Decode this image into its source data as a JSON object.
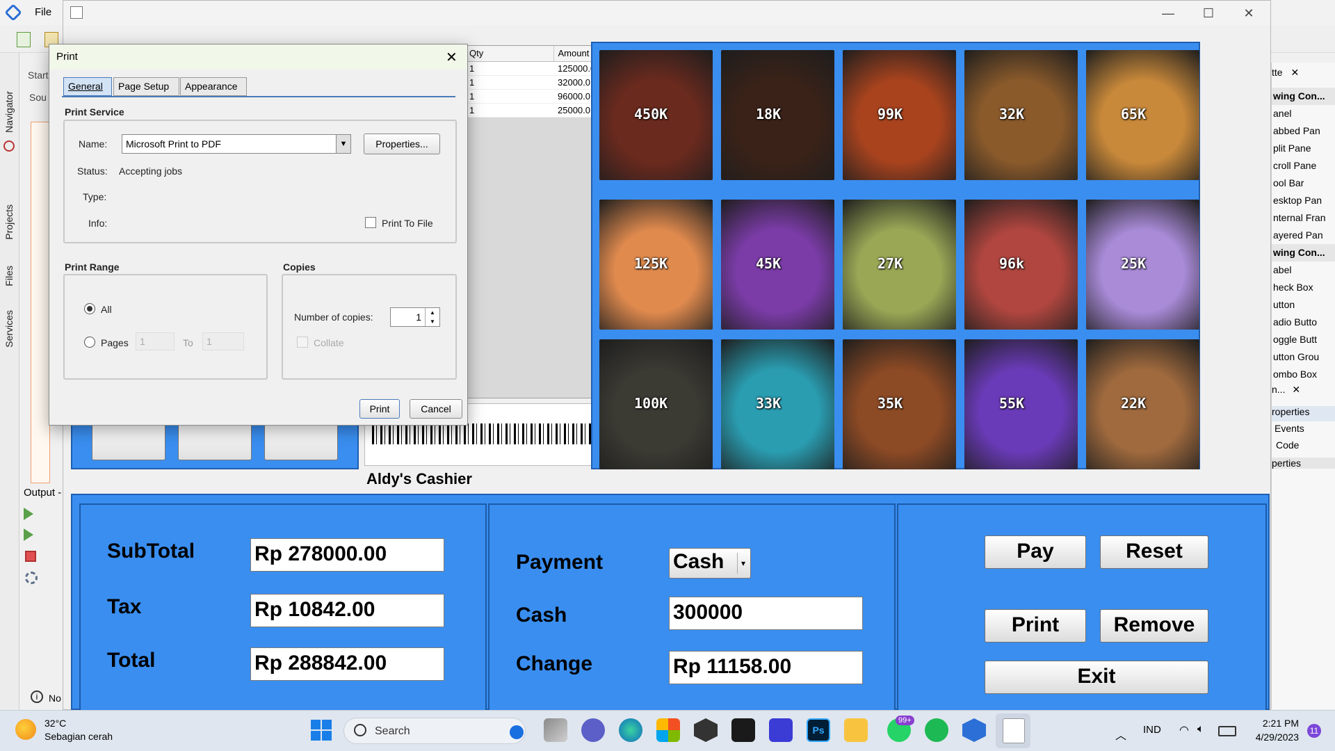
{
  "ide": {
    "menu_file": "File",
    "left_tabs": [
      "Navigator",
      "Projects",
      "Files",
      "Services"
    ],
    "output_label": "Output -",
    "start_tab": "Start",
    "source_tab": "Sou",
    "notifications_label": "No",
    "palette_items": [
      "wing Con...",
      "anel",
      "abbed Pan",
      "plit Pane",
      "croll Pane",
      "ool Bar",
      "esktop Pan",
      "nternal Fran",
      "ayered Pan",
      "wing Con...",
      "abel",
      "heck Box",
      "utton",
      "adio Butto",
      "oggle Butt",
      "utton Grou",
      "ombo Box"
    ],
    "palette_tab": "tte",
    "props_items": [
      "roperties",
      "Events",
      "Code"
    ],
    "props_tab": "n...",
    "props_footer": "perties"
  },
  "app": {
    "title": "Aldy's Cashier",
    "table": {
      "headers": [
        "Qty",
        "Amount"
      ],
      "rows": [
        {
          "qty": "1",
          "amount": "125000.0"
        },
        {
          "qty": "1",
          "amount": "32000.0"
        },
        {
          "qty": "1",
          "amount": "96000.0"
        },
        {
          "qty": "1",
          "amount": "25000.0"
        }
      ]
    },
    "products": [
      {
        "price": "450K",
        "color": "#6b2a1e"
      },
      {
        "price": "18K",
        "color": "#3a2218"
      },
      {
        "price": "99K",
        "color": "#a8431e"
      },
      {
        "price": "32K",
        "color": "#8a5a2b"
      },
      {
        "price": "65K",
        "color": "#c9893a"
      },
      {
        "price": "125K",
        "color": "#e08a4e"
      },
      {
        "price": "45K",
        "color": "#7b3ca8"
      },
      {
        "price": "27K",
        "color": "#9aa856"
      },
      {
        "price": "96k",
        "color": "#b0463f"
      },
      {
        "price": "25K",
        "color": "#a98bd8"
      },
      {
        "price": "100K",
        "color": "#3b3a33"
      },
      {
        "price": "33K",
        "color": "#2a9db1"
      },
      {
        "price": "35K",
        "color": "#8c4a25"
      },
      {
        "price": "55K",
        "color": "#6a3bb8"
      },
      {
        "price": "22K",
        "color": "#a06a3e"
      }
    ],
    "labels": {
      "subtotal": "SubTotal",
      "tax": "Tax",
      "total": "Total",
      "payment": "Payment",
      "cash": "Cash",
      "change": "Change"
    },
    "values": {
      "subtotal": "Rp 278000.00",
      "tax": "Rp 10842.00",
      "total": "Rp 288842.00",
      "payment_method": "Cash",
      "cash": "300000",
      "change": "Rp 11158.00"
    },
    "buttons": {
      "pay": "Pay",
      "reset": "Reset",
      "print": "Print",
      "remove": "Remove",
      "exit": "Exit"
    }
  },
  "print_dialog": {
    "title": "Print",
    "tabs": [
      "General",
      "Page Setup",
      "Appearance"
    ],
    "print_service": "Print Service",
    "name_label": "Name:",
    "printer_name": "Microsoft Print to PDF",
    "properties_button": "Properties...",
    "status_label": "Status:",
    "status_value": "Accepting jobs",
    "type_label": "Type:",
    "info_label": "Info:",
    "print_to_file": "Print To File",
    "print_range": "Print Range",
    "all_label": "All",
    "pages_label": "Pages",
    "pages_from": "1",
    "to_label": "To",
    "pages_to": "1",
    "copies": "Copies",
    "copies_label": "Number of copies:",
    "copies_value": "1",
    "collate": "Collate",
    "print_button": "Print",
    "cancel_button": "Cancel"
  },
  "taskbar": {
    "temperature": "32°C",
    "weather": "Sebagian cerah",
    "search": "Search",
    "language": "IND",
    "time": "2:21 PM",
    "date": "4/29/2023",
    "whatsapp_badge": "99+",
    "notification_count": "11"
  }
}
